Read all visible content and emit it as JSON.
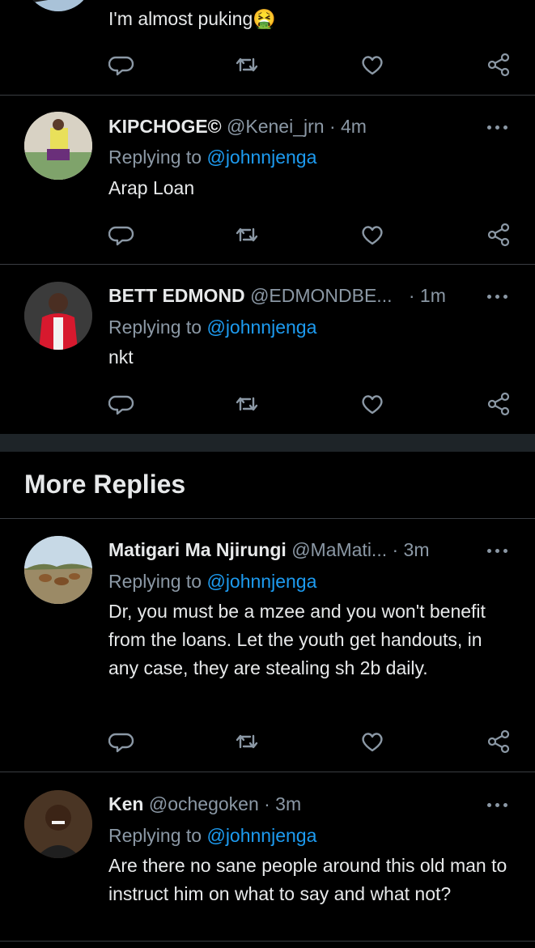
{
  "tweets": [
    {
      "text": "I'm almost puking🤮"
    },
    {
      "name": "KIPCHOGE©",
      "handle": "@Kenei_jrn",
      "time": "· 4m",
      "reply_prefix": "Replying to",
      "mention": "@johnnjenga",
      "text": "Arap Loan",
      "avatar": "person-on-bench-avatar"
    },
    {
      "name": "BETT EDMOND",
      "handle": "@EDMONDBE...",
      "time": "· 1m",
      "reply_prefix": "Replying to",
      "mention": "@johnnjenga",
      "text": "nkt",
      "avatar": "footballer-red-kit-avatar"
    },
    {
      "name": "Matigari Ma Njirungi",
      "handle": "@MaMati...",
      "time": "· 3m",
      "reply_prefix": "Replying to",
      "mention": "@johnnjenga",
      "text": "Dr, you must be a mzee and you won't benefit from the loans. Let the youth get handouts, in any case, they are stealing sh 2b daily.",
      "avatar": "antelopes-avatar"
    },
    {
      "name": "Ken",
      "handle": "@ochegoken",
      "time": "· 3m",
      "reply_prefix": "Replying to",
      "mention": "@johnnjenga",
      "text": "Are there no sane people around this old man to instruct him on what to say and what not?",
      "avatar": "smiling-man-avatar"
    }
  ],
  "section": {
    "more_replies": "More Replies"
  },
  "colors": {
    "background": "#000000",
    "text": "#e7e9ea",
    "muted": "#8b98a5",
    "link": "#1d9bf0",
    "divider": "#3a3d42"
  },
  "icons": [
    "reply-icon",
    "retweet-icon",
    "like-icon",
    "share-icon",
    "more-options-icon"
  ]
}
